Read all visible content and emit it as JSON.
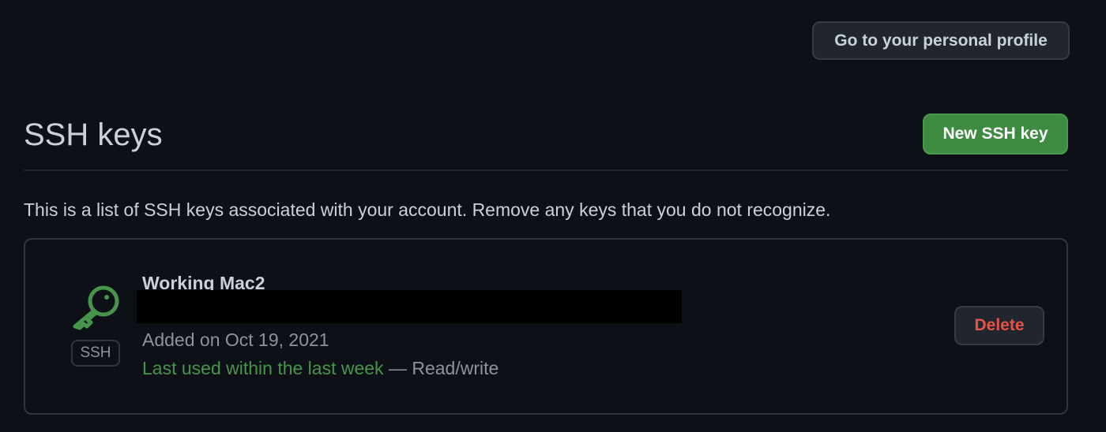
{
  "header": {
    "profile_button_label": "Go to your personal profile"
  },
  "section": {
    "title": "SSH keys",
    "new_key_button_label": "New SSH key",
    "description": "This is a list of SSH keys associated with your account. Remove any keys that you do not recognize."
  },
  "keys": [
    {
      "title": "Working Mac2",
      "type_badge": "SSH",
      "icon": "key-icon",
      "fingerprint_redacted": true,
      "added": "Added on Oct 19, 2021",
      "last_used": "Last used within the last week",
      "access": " — Read/write",
      "delete_label": "Delete"
    }
  ],
  "colors": {
    "background": "#0d1117",
    "accent_green": "#3d8b40",
    "danger_red": "#e5534b",
    "muted_text": "#8b949e"
  }
}
